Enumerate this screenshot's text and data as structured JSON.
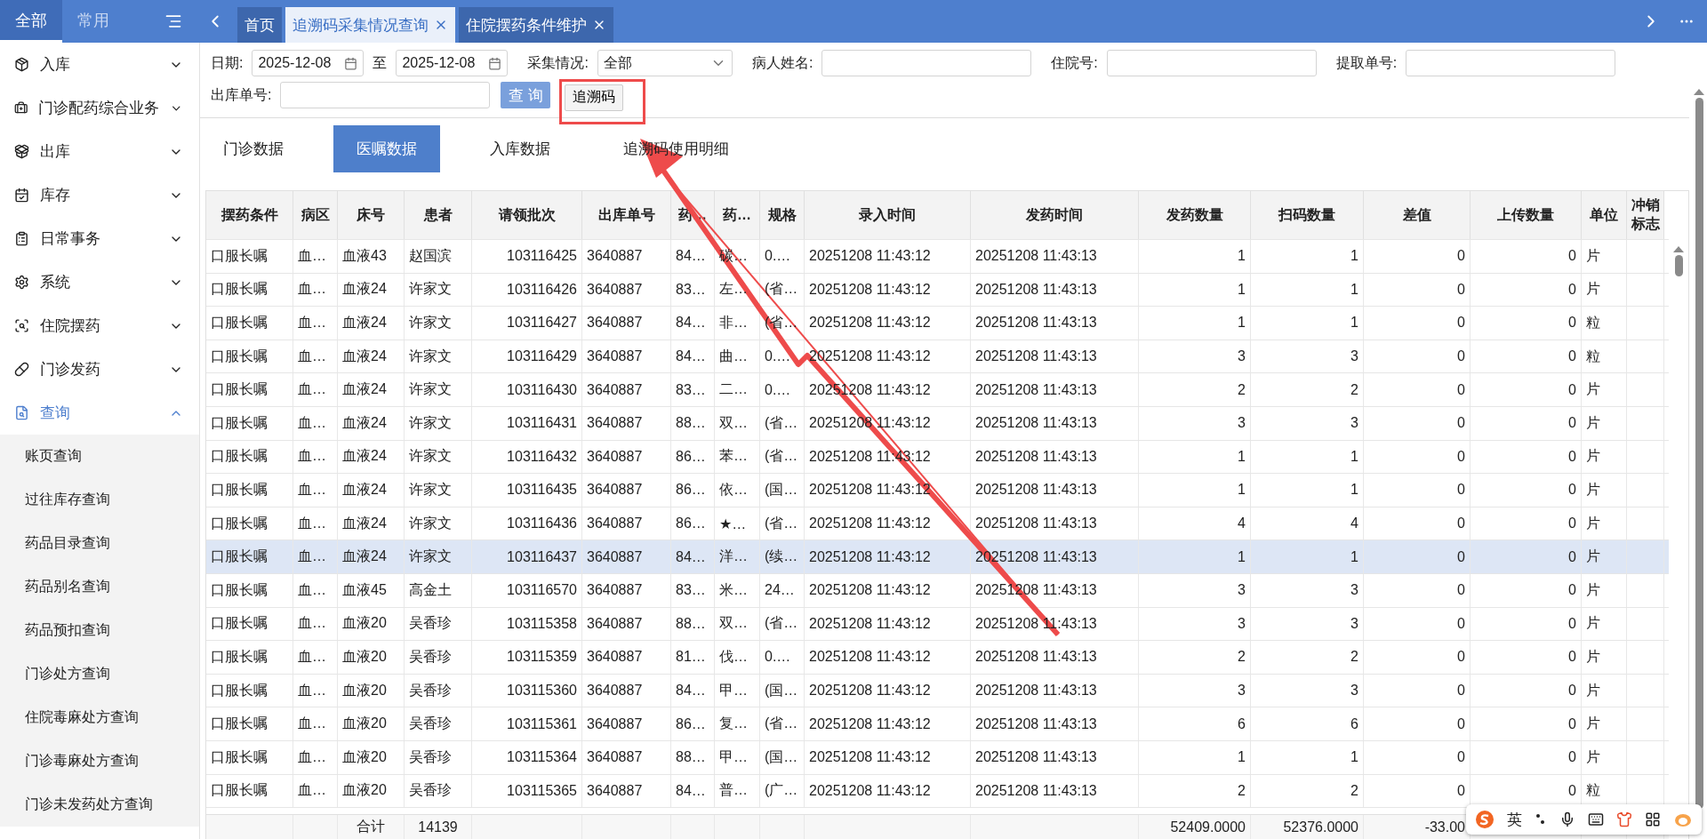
{
  "sidebar_tabs": [
    {
      "label": "全部",
      "selected": true
    },
    {
      "label": "常用",
      "selected": false
    }
  ],
  "tabs": [
    {
      "label": "首页",
      "selected": false,
      "closable": false
    },
    {
      "label": "追溯码采集情况查询",
      "selected": true,
      "closable": true
    },
    {
      "label": "住院摆药条件维护",
      "selected": false,
      "closable": true
    }
  ],
  "sidebar": {
    "items": [
      {
        "label": "入库",
        "expanded": false
      },
      {
        "label": "门诊配药综合业务",
        "expanded": false
      },
      {
        "label": "出库",
        "expanded": false
      },
      {
        "label": "库存",
        "expanded": false
      },
      {
        "label": "日常事务",
        "expanded": false
      },
      {
        "label": "系统",
        "expanded": false
      },
      {
        "label": "住院摆药",
        "expanded": false
      },
      {
        "label": "门诊发药",
        "expanded": false
      },
      {
        "label": "查询",
        "expanded": true,
        "children": [
          {
            "label": "账页查询"
          },
          {
            "label": "过往库存查询"
          },
          {
            "label": "药品目录查询"
          },
          {
            "label": "药品别名查询"
          },
          {
            "label": "药品预扣查询"
          },
          {
            "label": "门诊处方查询"
          },
          {
            "label": "住院毒麻处方查询"
          },
          {
            "label": "门诊毒麻处方查询"
          },
          {
            "label": "门诊未发药处方查询"
          }
        ]
      }
    ]
  },
  "filters": [
    [
      {
        "label": "日期:",
        "kind": "date",
        "value": "2025-12-08"
      },
      {
        "label": "至",
        "kind": "date",
        "value": "2025-12-08"
      },
      {
        "label": "采集情况:",
        "kind": "select",
        "value": "全部"
      },
      {
        "label": "病人姓名:",
        "kind": "text"
      },
      {
        "label": "住院号:",
        "kind": "text"
      },
      {
        "label": "提取单号:",
        "kind": "text"
      }
    ],
    [
      {
        "label": "出库单号:",
        "kind": "text"
      },
      {
        "label": "查 询",
        "kind": "primary"
      },
      {
        "label": "追溯码",
        "kind": "button",
        "highlighted": true
      }
    ]
  ],
  "content_tabs": [
    {
      "label": "门诊数据",
      "selected": false
    },
    {
      "label": "医嘱数据",
      "selected": true
    },
    {
      "label": "入库数据",
      "selected": false
    },
    {
      "label": "追溯码使用明细",
      "selected": false
    }
  ],
  "table": {
    "columns": [
      "摆药条件",
      "病区",
      "床号",
      "患者",
      "请领批次",
      "出库单号",
      "药…",
      "药…",
      "规格",
      "录入时间",
      "发药时间",
      "发药数量",
      "扫码数量",
      "差值",
      "上传数量",
      "单位",
      "冲销标志"
    ],
    "rows": [
      {
        "selected": false,
        "cells": [
          "口服长嘱",
          "血…",
          "血液43",
          "赵国滨",
          "103116425",
          "3640887",
          "84…",
          "碳…",
          "0.…",
          "20251208 11:43:12",
          "20251208 11:43:13",
          "1",
          "1",
          "0",
          "0",
          "片"
        ]
      },
      {
        "selected": false,
        "cells": [
          "口服长嘱",
          "血…",
          "血液24",
          "许家文",
          "103116426",
          "3640887",
          "83…",
          "左…",
          "(省…",
          "20251208 11:43:12",
          "20251208 11:43:13",
          "1",
          "1",
          "0",
          "0",
          "片"
        ]
      },
      {
        "selected": false,
        "cells": [
          "口服长嘱",
          "血…",
          "血液24",
          "许家文",
          "103116427",
          "3640887",
          "84…",
          "非…",
          "(省…",
          "20251208 11:43:12",
          "20251208 11:43:13",
          "1",
          "1",
          "0",
          "0",
          "粒"
        ]
      },
      {
        "selected": false,
        "cells": [
          "口服长嘱",
          "血…",
          "血液24",
          "许家文",
          "103116429",
          "3640887",
          "84…",
          "曲…",
          "0.…",
          "20251208 11:43:12",
          "20251208 11:43:13",
          "3",
          "3",
          "0",
          "0",
          "粒"
        ]
      },
      {
        "selected": false,
        "cells": [
          "口服长嘱",
          "血…",
          "血液24",
          "许家文",
          "103116430",
          "3640887",
          "83…",
          "二…",
          "0.…",
          "20251208 11:43:12",
          "20251208 11:43:13",
          "2",
          "2",
          "0",
          "0",
          "片"
        ]
      },
      {
        "selected": false,
        "cells": [
          "口服长嘱",
          "血…",
          "血液24",
          "许家文",
          "103116431",
          "3640887",
          "88…",
          "双…",
          "(省…",
          "20251208 11:43:12",
          "20251208 11:43:13",
          "3",
          "3",
          "0",
          "0",
          "片"
        ]
      },
      {
        "selected": false,
        "cells": [
          "口服长嘱",
          "血…",
          "血液24",
          "许家文",
          "103116432",
          "3640887",
          "86…",
          "苯…",
          "(省…",
          "20251208 11:43:12",
          "20251208 11:43:13",
          "1",
          "1",
          "0",
          "0",
          "片"
        ]
      },
      {
        "selected": false,
        "cells": [
          "口服长嘱",
          "血…",
          "血液24",
          "许家文",
          "103116435",
          "3640887",
          "86…",
          "依…",
          "(国…",
          "20251208 11:43:12",
          "20251208 11:43:13",
          "1",
          "1",
          "0",
          "0",
          "片"
        ]
      },
      {
        "selected": false,
        "cells": [
          "口服长嘱",
          "血…",
          "血液24",
          "许家文",
          "103116436",
          "3640887",
          "86…",
          "★…",
          "(省…",
          "20251208 11:43:12",
          "20251208 11:43:13",
          "4",
          "4",
          "0",
          "0",
          "片"
        ]
      },
      {
        "selected": true,
        "cells": [
          "口服长嘱",
          "血…",
          "血液24",
          "许家文",
          "103116437",
          "3640887",
          "84…",
          "洋…",
          "(续…",
          "20251208 11:43:12",
          "20251208 11:43:13",
          "1",
          "1",
          "0",
          "0",
          "片"
        ]
      },
      {
        "selected": false,
        "cells": [
          "口服长嘱",
          "血…",
          "血液45",
          "高金土",
          "103116570",
          "3640887",
          "83…",
          "米…",
          "24…",
          "20251208 11:43:12",
          "20251208 11:43:13",
          "3",
          "3",
          "0",
          "0",
          "片"
        ]
      },
      {
        "selected": false,
        "cells": [
          "口服长嘱",
          "血…",
          "血液20",
          "吴香珍",
          "103115358",
          "3640887",
          "88…",
          "双…",
          "(省…",
          "20251208 11:43:12",
          "20251208 11:43:13",
          "3",
          "3",
          "0",
          "0",
          "片"
        ]
      },
      {
        "selected": false,
        "cells": [
          "口服长嘱",
          "血…",
          "血液20",
          "吴香珍",
          "103115359",
          "3640887",
          "81…",
          "伐…",
          "0.…",
          "20251208 11:43:12",
          "20251208 11:43:13",
          "2",
          "2",
          "0",
          "0",
          "片"
        ]
      },
      {
        "selected": false,
        "cells": [
          "口服长嘱",
          "血…",
          "血液20",
          "吴香珍",
          "103115360",
          "3640887",
          "84…",
          "甲…",
          "(国…",
          "20251208 11:43:12",
          "20251208 11:43:13",
          "3",
          "3",
          "0",
          "0",
          "片"
        ]
      },
      {
        "selected": false,
        "cells": [
          "口服长嘱",
          "血…",
          "血液20",
          "吴香珍",
          "103115361",
          "3640887",
          "86…",
          "复…",
          "(省…",
          "20251208 11:43:12",
          "20251208 11:43:13",
          "6",
          "6",
          "0",
          "0",
          "片"
        ]
      },
      {
        "selected": false,
        "cells": [
          "口服长嘱",
          "血…",
          "血液20",
          "吴香珍",
          "103115364",
          "3640887",
          "88…",
          "甲…",
          "(国…",
          "20251208 11:43:12",
          "20251208 11:43:13",
          "1",
          "1",
          "0",
          "0",
          "片"
        ]
      },
      {
        "selected": false,
        "cells": [
          "口服长嘱",
          "血…",
          "血液20",
          "吴香珍",
          "103115365",
          "3640887",
          "84…",
          "普…",
          "(广…",
          "20251208 11:43:12",
          "20251208 11:43:13",
          "2",
          "2",
          "0",
          "0",
          "粒"
        ]
      }
    ],
    "totals": {
      "label": "合计",
      "batches": "14139",
      "dispensed_qty": "52409.0000",
      "scanned_qty": "52376.0000",
      "difference": "-33.00"
    }
  },
  "ime_toolbar": {
    "mode": "英"
  }
}
